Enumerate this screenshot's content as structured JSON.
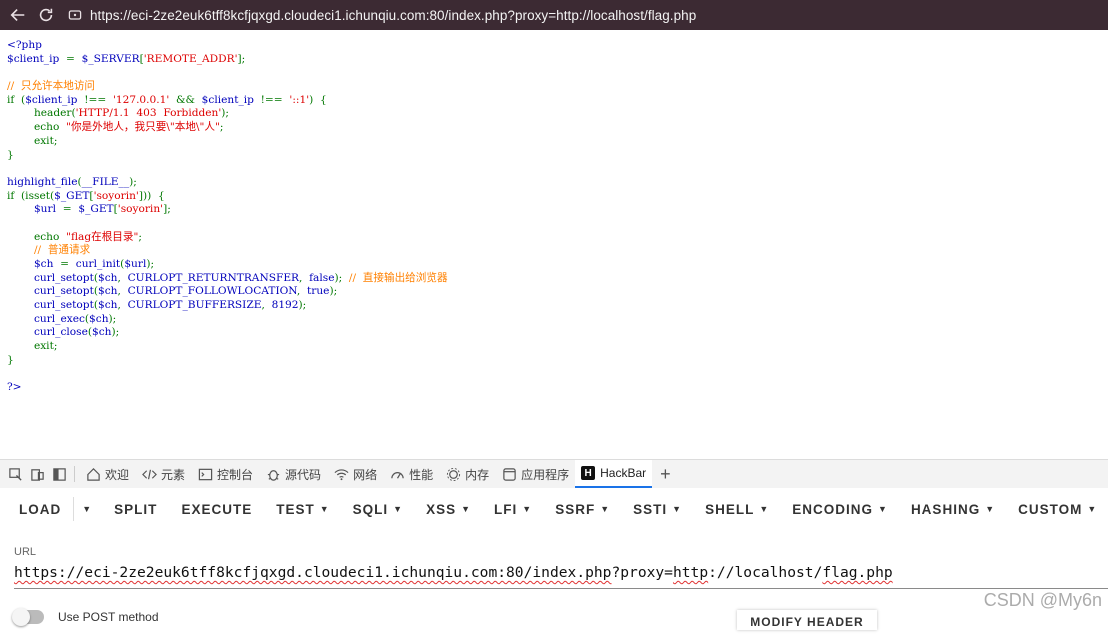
{
  "browser": {
    "address_url": "https://eci-2ze2euk6tff8kcfjqxgd.cloudeci1.ichunqiu.com:80/index.php?proxy=http://localhost/flag.php"
  },
  "source_code": {
    "lines": [
      [
        {
          "c": "c-html",
          "t": "<?php"
        }
      ],
      [
        {
          "c": "c-var",
          "t": "$client_ip"
        },
        {
          "c": "c-kw",
          "t": "  =  "
        },
        {
          "c": "c-var",
          "t": "$_SERVER"
        },
        {
          "c": "c-kw",
          "t": "["
        },
        {
          "c": "c-str",
          "t": "'REMOTE_ADDR'"
        },
        {
          "c": "c-kw",
          "t": "];"
        }
      ],
      [],
      [
        {
          "c": "c-cmt",
          "t": "//  只允许本地访问"
        }
      ],
      [
        {
          "c": "c-kw",
          "t": "if  ("
        },
        {
          "c": "c-var",
          "t": "$client_ip"
        },
        {
          "c": "c-kw",
          "t": "  !==  "
        },
        {
          "c": "c-str",
          "t": "'127.0.0.1'"
        },
        {
          "c": "c-kw",
          "t": "  &&  "
        },
        {
          "c": "c-var",
          "t": "$client_ip"
        },
        {
          "c": "c-kw",
          "t": "  !==  "
        },
        {
          "c": "c-str",
          "t": "'::1'"
        },
        {
          "c": "c-kw",
          "t": ")  {"
        }
      ],
      [
        {
          "c": "c-kw",
          "t": "        header("
        },
        {
          "c": "c-str",
          "t": "'HTTP/1.1  403  Forbidden'"
        },
        {
          "c": "c-kw",
          "t": ");"
        }
      ],
      [
        {
          "c": "c-kw",
          "t": "        echo  "
        },
        {
          "c": "c-str",
          "t": "\"你是外地人，我只要\\\"本地\\\"人\""
        },
        {
          "c": "c-kw",
          "t": ";"
        }
      ],
      [
        {
          "c": "c-kw",
          "t": "        exit;"
        }
      ],
      [
        {
          "c": "c-kw",
          "t": "}"
        }
      ],
      [],
      [
        {
          "c": "c-var",
          "t": "highlight_file"
        },
        {
          "c": "c-kw",
          "t": "("
        },
        {
          "c": "c-var",
          "t": "__FILE__"
        },
        {
          "c": "c-kw",
          "t": ");"
        }
      ],
      [
        {
          "c": "c-kw",
          "t": "if  (isset("
        },
        {
          "c": "c-var",
          "t": "$_GET"
        },
        {
          "c": "c-kw",
          "t": "["
        },
        {
          "c": "c-str",
          "t": "'soyorin'"
        },
        {
          "c": "c-kw",
          "t": "]))  {"
        }
      ],
      [
        {
          "c": "c-var",
          "t": "        $url"
        },
        {
          "c": "c-kw",
          "t": "  =  "
        },
        {
          "c": "c-var",
          "t": "$_GET"
        },
        {
          "c": "c-kw",
          "t": "["
        },
        {
          "c": "c-str",
          "t": "'soyorin'"
        },
        {
          "c": "c-kw",
          "t": "];"
        }
      ],
      [],
      [
        {
          "c": "c-kw",
          "t": "        echo  "
        },
        {
          "c": "c-str",
          "t": "\"flag在根目录\""
        },
        {
          "c": "c-kw",
          "t": ";"
        }
      ],
      [
        {
          "c": "c-cmt",
          "t": "        //  普通请求"
        }
      ],
      [
        {
          "c": "c-var",
          "t": "        $ch"
        },
        {
          "c": "c-kw",
          "t": "  =  "
        },
        {
          "c": "c-var",
          "t": "curl_init"
        },
        {
          "c": "c-kw",
          "t": "("
        },
        {
          "c": "c-var",
          "t": "$url"
        },
        {
          "c": "c-kw",
          "t": ");"
        }
      ],
      [
        {
          "c": "c-var",
          "t": "        curl_setopt"
        },
        {
          "c": "c-kw",
          "t": "("
        },
        {
          "c": "c-var",
          "t": "$ch"
        },
        {
          "c": "c-kw",
          "t": ",  "
        },
        {
          "c": "c-var",
          "t": "CURLOPT_RETURNTRANSFER"
        },
        {
          "c": "c-kw",
          "t": ",  "
        },
        {
          "c": "c-var",
          "t": "false"
        },
        {
          "c": "c-kw",
          "t": ");  "
        },
        {
          "c": "c-cmt",
          "t": "//  直接输出给浏览器"
        }
      ],
      [
        {
          "c": "c-var",
          "t": "        curl_setopt"
        },
        {
          "c": "c-kw",
          "t": "("
        },
        {
          "c": "c-var",
          "t": "$ch"
        },
        {
          "c": "c-kw",
          "t": ",  "
        },
        {
          "c": "c-var",
          "t": "CURLOPT_FOLLOWLOCATION"
        },
        {
          "c": "c-kw",
          "t": ",  "
        },
        {
          "c": "c-var",
          "t": "true"
        },
        {
          "c": "c-kw",
          "t": ");"
        }
      ],
      [
        {
          "c": "c-var",
          "t": "        curl_setopt"
        },
        {
          "c": "c-kw",
          "t": "("
        },
        {
          "c": "c-var",
          "t": "$ch"
        },
        {
          "c": "c-kw",
          "t": ",  "
        },
        {
          "c": "c-var",
          "t": "CURLOPT_BUFFERSIZE"
        },
        {
          "c": "c-kw",
          "t": ",  "
        },
        {
          "c": "c-var",
          "t": "8192"
        },
        {
          "c": "c-kw",
          "t": ");"
        }
      ],
      [
        {
          "c": "c-var",
          "t": "        curl_exec"
        },
        {
          "c": "c-kw",
          "t": "("
        },
        {
          "c": "c-var",
          "t": "$ch"
        },
        {
          "c": "c-kw",
          "t": ");"
        }
      ],
      [
        {
          "c": "c-var",
          "t": "        curl_close"
        },
        {
          "c": "c-kw",
          "t": "("
        },
        {
          "c": "c-var",
          "t": "$ch"
        },
        {
          "c": "c-kw",
          "t": ");"
        }
      ],
      [
        {
          "c": "c-kw",
          "t": "        exit;"
        }
      ],
      [
        {
          "c": "c-kw",
          "t": "}"
        }
      ],
      [],
      [
        {
          "c": "c-html",
          "t": "?>"
        }
      ]
    ]
  },
  "devtools": {
    "tabs": [
      {
        "label": "欢迎",
        "icon": "home-icon"
      },
      {
        "label": "元素",
        "icon": "code-brackets-icon"
      },
      {
        "label": "控制台",
        "icon": "console-icon"
      },
      {
        "label": "源代码",
        "icon": "bug-icon"
      },
      {
        "label": "网络",
        "icon": "wifi-icon"
      },
      {
        "label": "性能",
        "icon": "gauge-icon"
      },
      {
        "label": "内存",
        "icon": "chip-icon"
      },
      {
        "label": "应用程序",
        "icon": "app-window-icon"
      },
      {
        "label": "HackBar",
        "icon": "hackbar-logo-icon",
        "active": true
      }
    ]
  },
  "hackbar": {
    "load_label": "LOAD",
    "buttons": [
      {
        "label": "SPLIT",
        "dropdown": false
      },
      {
        "label": "EXECUTE",
        "dropdown": false
      },
      {
        "label": "TEST",
        "dropdown": true
      },
      {
        "label": "SQLI",
        "dropdown": true
      },
      {
        "label": "XSS",
        "dropdown": true
      },
      {
        "label": "LFI",
        "dropdown": true
      },
      {
        "label": "SSRF",
        "dropdown": true
      },
      {
        "label": "SSTI",
        "dropdown": true
      },
      {
        "label": "SHELL",
        "dropdown": true
      },
      {
        "label": "ENCODING",
        "dropdown": true
      },
      {
        "label": "HASHING",
        "dropdown": true
      },
      {
        "label": "CUSTOM",
        "dropdown": true
      }
    ],
    "url_label": "URL",
    "url_value_underlined": "https://eci-2ze2euk6tff8kcfjqxgd.cloudeci1.ichunqiu.com:80/index.php",
    "url_value_plain": "?proxy=",
    "url_value_underlined2": "http",
    "url_value_plain2": "://localhost/",
    "url_value_underlined3": "flag.php",
    "post_label": "Use POST method",
    "modify_label": "MODIFY HEADER"
  },
  "watermark": "CSDN @My6n"
}
